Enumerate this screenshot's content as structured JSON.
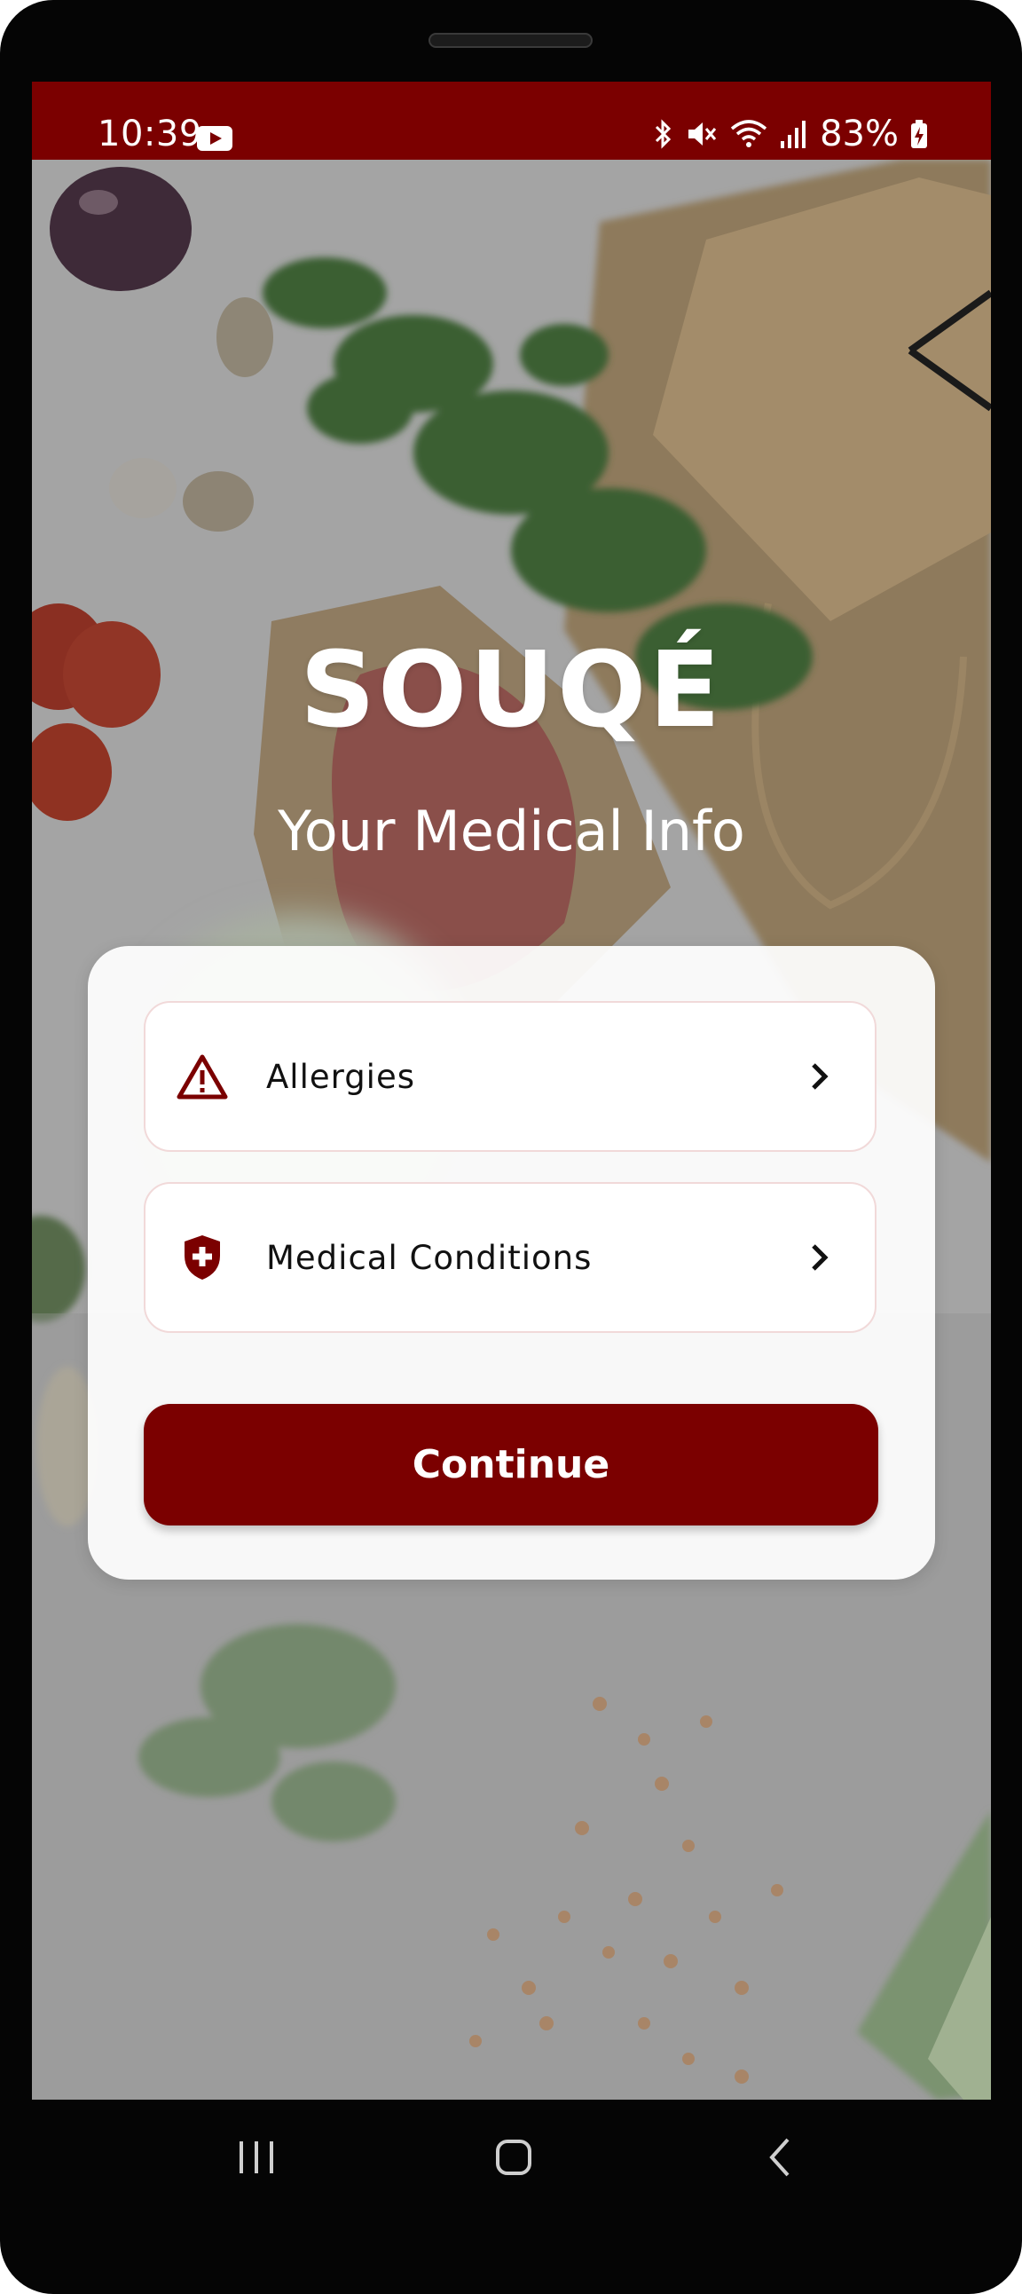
{
  "status_bar": {
    "time": "10:39",
    "battery": "83%",
    "icons": [
      "youtube-icon",
      "bluetooth-icon",
      "mute-icon",
      "wifi-icon",
      "signal-icon",
      "battery-charging-icon"
    ]
  },
  "header": {
    "app_name": "SOUQÉ",
    "subtitle": "Your Medical Info"
  },
  "options": [
    {
      "label": "Allergies",
      "icon": "warning-triangle-icon"
    },
    {
      "label": "Medical Conditions",
      "icon": "medical-shield-icon"
    }
  ],
  "continue_label": "Continue",
  "nav": [
    "recent-apps-icon",
    "home-icon",
    "back-icon"
  ],
  "colors": {
    "brand": "#7b0000",
    "card": "#ffffff",
    "background": "#9b9b9b"
  }
}
